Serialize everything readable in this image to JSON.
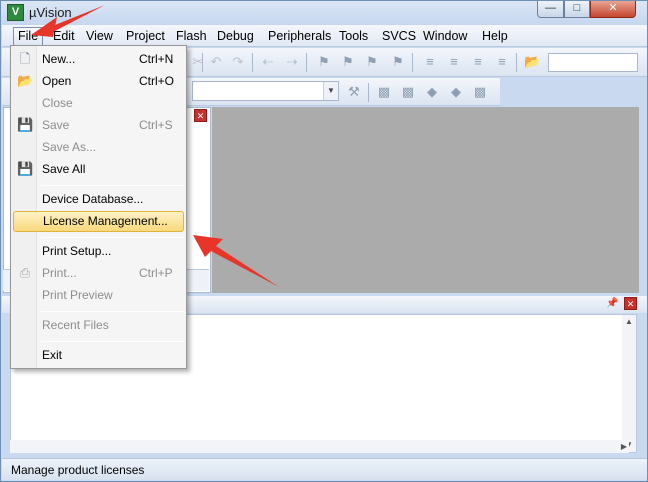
{
  "window": {
    "title": "µVision",
    "app_icon_letter": "V"
  },
  "menubar": {
    "items": [
      "File",
      "Edit",
      "View",
      "Project",
      "Flash",
      "Debug",
      "Peripherals",
      "Tools",
      "SVCS",
      "Window",
      "Help"
    ],
    "active": "File"
  },
  "file_menu": {
    "items": [
      {
        "label": "New...",
        "shortcut": "Ctrl+N",
        "enabled": true,
        "icon": "new-file-icon"
      },
      {
        "label": "Open",
        "shortcut": "Ctrl+O",
        "enabled": true,
        "icon": "open-folder-icon"
      },
      {
        "label": "Close",
        "shortcut": "",
        "enabled": false,
        "icon": ""
      },
      {
        "label": "Save",
        "shortcut": "Ctrl+S",
        "enabled": false,
        "icon": "save-icon"
      },
      {
        "label": "Save As...",
        "shortcut": "",
        "enabled": false,
        "icon": ""
      },
      {
        "label": "Save All",
        "shortcut": "",
        "enabled": true,
        "icon": "save-all-icon"
      },
      {
        "label": "Device Database...",
        "shortcut": "",
        "enabled": true,
        "icon": ""
      },
      {
        "label": "License Management...",
        "shortcut": "",
        "enabled": true,
        "icon": "",
        "highlighted": true
      },
      {
        "label": "Print Setup...",
        "shortcut": "",
        "enabled": true,
        "icon": ""
      },
      {
        "label": "Print...",
        "shortcut": "Ctrl+P",
        "enabled": false,
        "icon": "print-icon"
      },
      {
        "label": "Print Preview",
        "shortcut": "",
        "enabled": false,
        "icon": ""
      },
      {
        "label": "Recent Files",
        "shortcut": "",
        "enabled": false,
        "icon": ""
      },
      {
        "label": "Exit",
        "shortcut": "",
        "enabled": true,
        "icon": ""
      }
    ]
  },
  "statusbar": {
    "text": "Manage product licenses"
  },
  "colors": {
    "highlight": "#f9d97c",
    "annotation_arrow": "#e8352a",
    "editor_bg": "#ababab"
  }
}
